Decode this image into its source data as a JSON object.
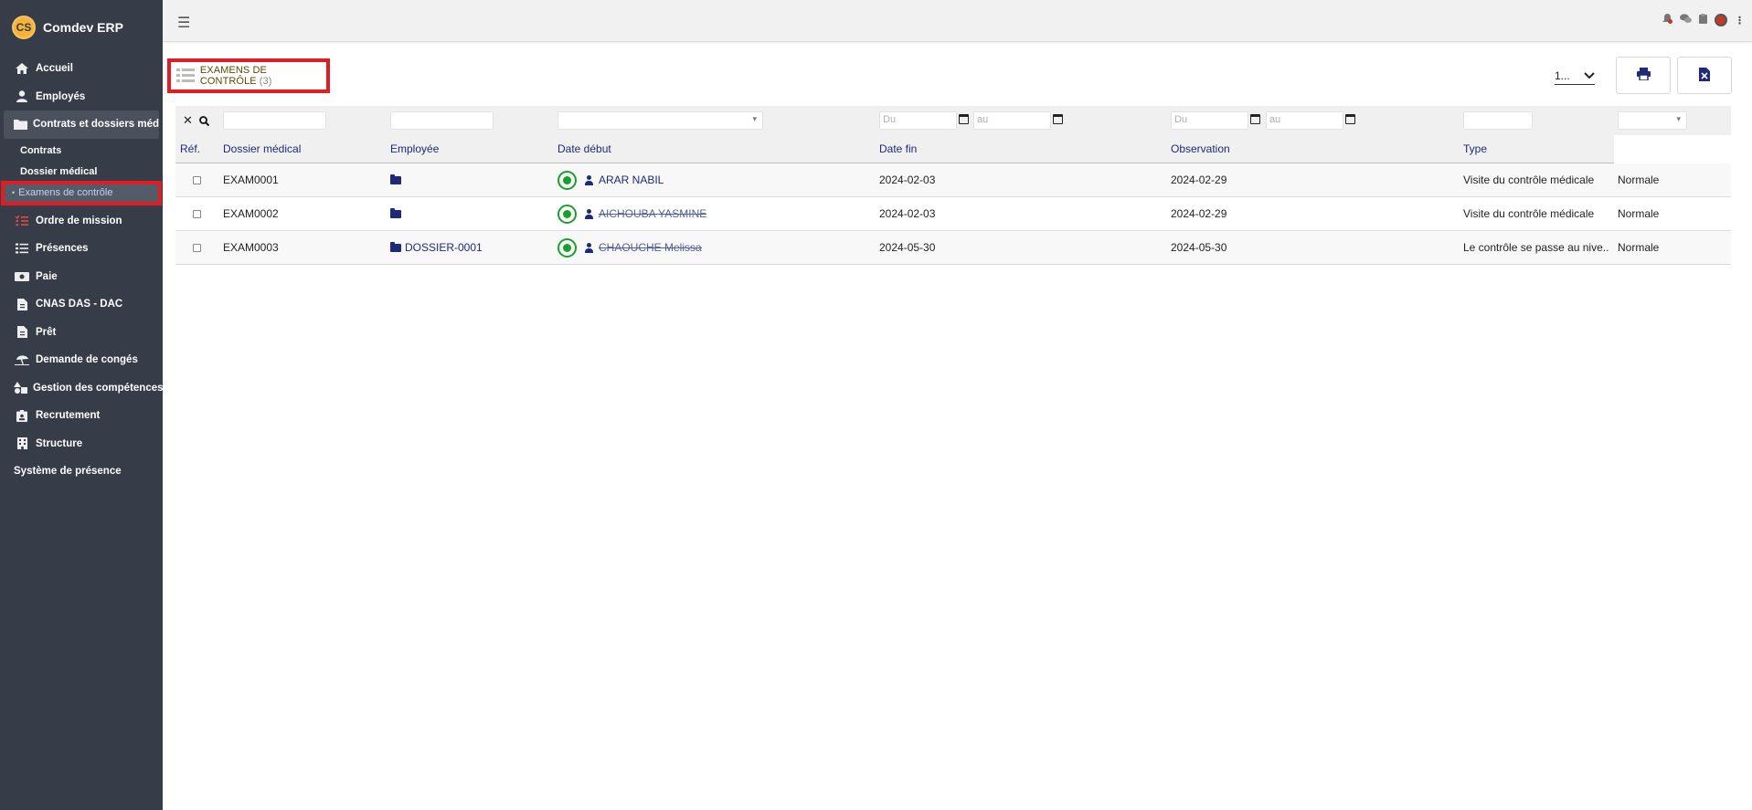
{
  "app": {
    "logo_text": "CS",
    "title": "Comdev ERP"
  },
  "sidebar": {
    "items": [
      {
        "label": "Accueil",
        "icon": "home-icon"
      },
      {
        "label": "Employés",
        "icon": "user-icon"
      },
      {
        "label": "Contrats et dossiers médicaux",
        "icon": "folder-icon",
        "active": true
      },
      {
        "label": "Ordre de mission",
        "icon": "list-check-icon"
      },
      {
        "label": "Présences",
        "icon": "list-icon"
      },
      {
        "label": "Paie",
        "icon": "money-icon"
      },
      {
        "label": "CNAS DAS - DAC",
        "icon": "file-icon"
      },
      {
        "label": "Prêt",
        "icon": "file-icon"
      },
      {
        "label": "Demande de congés",
        "icon": "umbrella-beach-icon"
      },
      {
        "label": "Gestion des compétences",
        "icon": "shapes-icon"
      },
      {
        "label": "Recrutement",
        "icon": "id-badge-icon"
      },
      {
        "label": "Structure",
        "icon": "building-icon"
      },
      {
        "label": "Système de présence",
        "icon": ""
      }
    ],
    "sub_items": [
      {
        "label": "Contrats"
      },
      {
        "label": "Dossier médical"
      },
      {
        "label": "Examens de contrôle",
        "current": true
      }
    ]
  },
  "header": {
    "page_title": "EXAMENS DE CONTRÔLE",
    "count": "(3)",
    "pager_value": "1...",
    "print_icon": "print-icon",
    "excel_icon": "file-excel-icon"
  },
  "filters": {
    "date_from_placeholder": "Du",
    "date_to_placeholder": "au"
  },
  "table": {
    "columns": [
      "Réf.",
      "Dossier médical",
      "Employée",
      "Date début",
      "Date fin",
      "Observation",
      "Type"
    ],
    "rows": [
      {
        "ref": "EXAM0001",
        "dossier": "",
        "employee": "ARAR NABIL",
        "date_debut": "2024-02-03",
        "date_fin": "2024-02-29",
        "observation": "Visite du contrôle médicale",
        "type": "Normale"
      },
      {
        "ref": "EXAM0002",
        "dossier": "",
        "employee": "AICHOUBA YASMINE",
        "date_debut": "2024-02-03",
        "date_fin": "2024-02-29",
        "observation": "Visite du contrôle médicale",
        "type": "Normale"
      },
      {
        "ref": "EXAM0003",
        "dossier": "DOSSIER-0001",
        "employee": "CHAOUCHE Melissa",
        "date_debut": "2024-05-30",
        "date_fin": "2024-05-30",
        "observation": "Le contrôle se passe au nive...",
        "type": "Normale"
      }
    ]
  },
  "colors": {
    "sidebar_bg": "#363c48",
    "accent": "#1d2a7a",
    "highlight": "#e31b23",
    "whatsapp": "#18a02c"
  }
}
